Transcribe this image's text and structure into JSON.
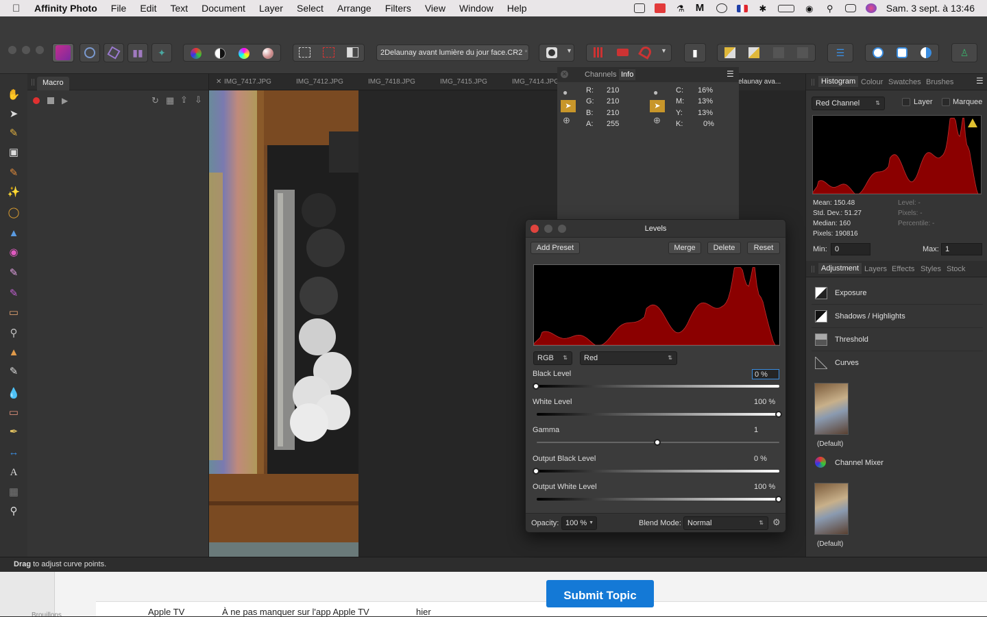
{
  "menubar": {
    "app_name": "Affinity Photo",
    "items": [
      "File",
      "Edit",
      "Text",
      "Document",
      "Layer",
      "Select",
      "Arrange",
      "Filters",
      "View",
      "Window",
      "Help"
    ],
    "clock": "Sam. 3 sept. à  13:46"
  },
  "toolbar": {
    "document_title": "2Delaunay avant lumière du jour face.CR2",
    "document_modified_marker": "*"
  },
  "macro_panel": {
    "tab_label": "Macro"
  },
  "document_tabs": [
    "IMG_7417.JPG",
    "IMG_7412.JPG",
    "IMG_7418.JPG",
    "IMG_7415.JPG",
    "IMG_7414.JPG",
    "elaunay ava..."
  ],
  "info_panel": {
    "tabs": [
      "Channels",
      "Info"
    ],
    "rgb": [
      {
        "label": "R:",
        "value": "210"
      },
      {
        "label": "G:",
        "value": "210"
      },
      {
        "label": "B:",
        "value": "210"
      },
      {
        "label": "A:",
        "value": "255"
      }
    ],
    "cmyk": [
      {
        "label": "C:",
        "value": "16%"
      },
      {
        "label": "M:",
        "value": "13%"
      },
      {
        "label": "Y:",
        "value": "13%"
      },
      {
        "label": "K:",
        "value": "0%"
      }
    ]
  },
  "histogram_panel": {
    "tabs": [
      "Histogram",
      "Colour",
      "Swatches",
      "Brushes"
    ],
    "channel_select": "Red Channel",
    "layer_label": "Layer",
    "marquee_label": "Marquee",
    "stats_left": [
      "Mean: 150.48",
      "Std. Dev.: 51.27",
      "Median: 160",
      "Pixels: 190816"
    ],
    "stats_right": [
      "Level: -",
      "Pixels: -",
      "Percentile: -"
    ],
    "min_label": "Min:",
    "min_value": "0",
    "max_label": "Max:",
    "max_value": "1",
    "histogram_color": "#8b0000"
  },
  "adjustment_panel": {
    "tabs": [
      "Adjustment",
      "Layers",
      "Effects",
      "Styles",
      "Stock"
    ],
    "items": [
      "Exposure",
      "Shadows / Highlights",
      "Threshold",
      "Curves",
      "Channel Mixer"
    ],
    "preset_label": "(Default)"
  },
  "levels_dialog": {
    "title": "Levels",
    "buttons": {
      "add_preset": "Add Preset",
      "merge": "Merge",
      "delete": "Delete",
      "reset": "Reset"
    },
    "mode_select": "RGB",
    "channel_select": "Red",
    "sliders": [
      {
        "label": "Black Level",
        "value": "0 %",
        "level": 0.0
      },
      {
        "label": "White Level",
        "value": "100 %",
        "level": 1.0
      },
      {
        "label": "Gamma",
        "value": "1",
        "level": 0.5
      },
      {
        "label": "Output Black Level",
        "value": "0 %",
        "level": 0.0
      },
      {
        "label": "Output White Level",
        "value": "100 %",
        "level": 1.0
      }
    ],
    "opacity_label": "Opacity:",
    "opacity_value": "100 %",
    "blend_label": "Blend Mode:",
    "blend_value": "Normal"
  },
  "status_bar": {
    "bold": "Drag",
    "text": " to adjust curve points."
  },
  "background_app": {
    "submit_label": "Submit Topic",
    "row_cells": [
      "Apple TV",
      "À ne pas manquer sur l'app Apple TV",
      "hier"
    ],
    "sidebar_text": "Brouillons"
  }
}
